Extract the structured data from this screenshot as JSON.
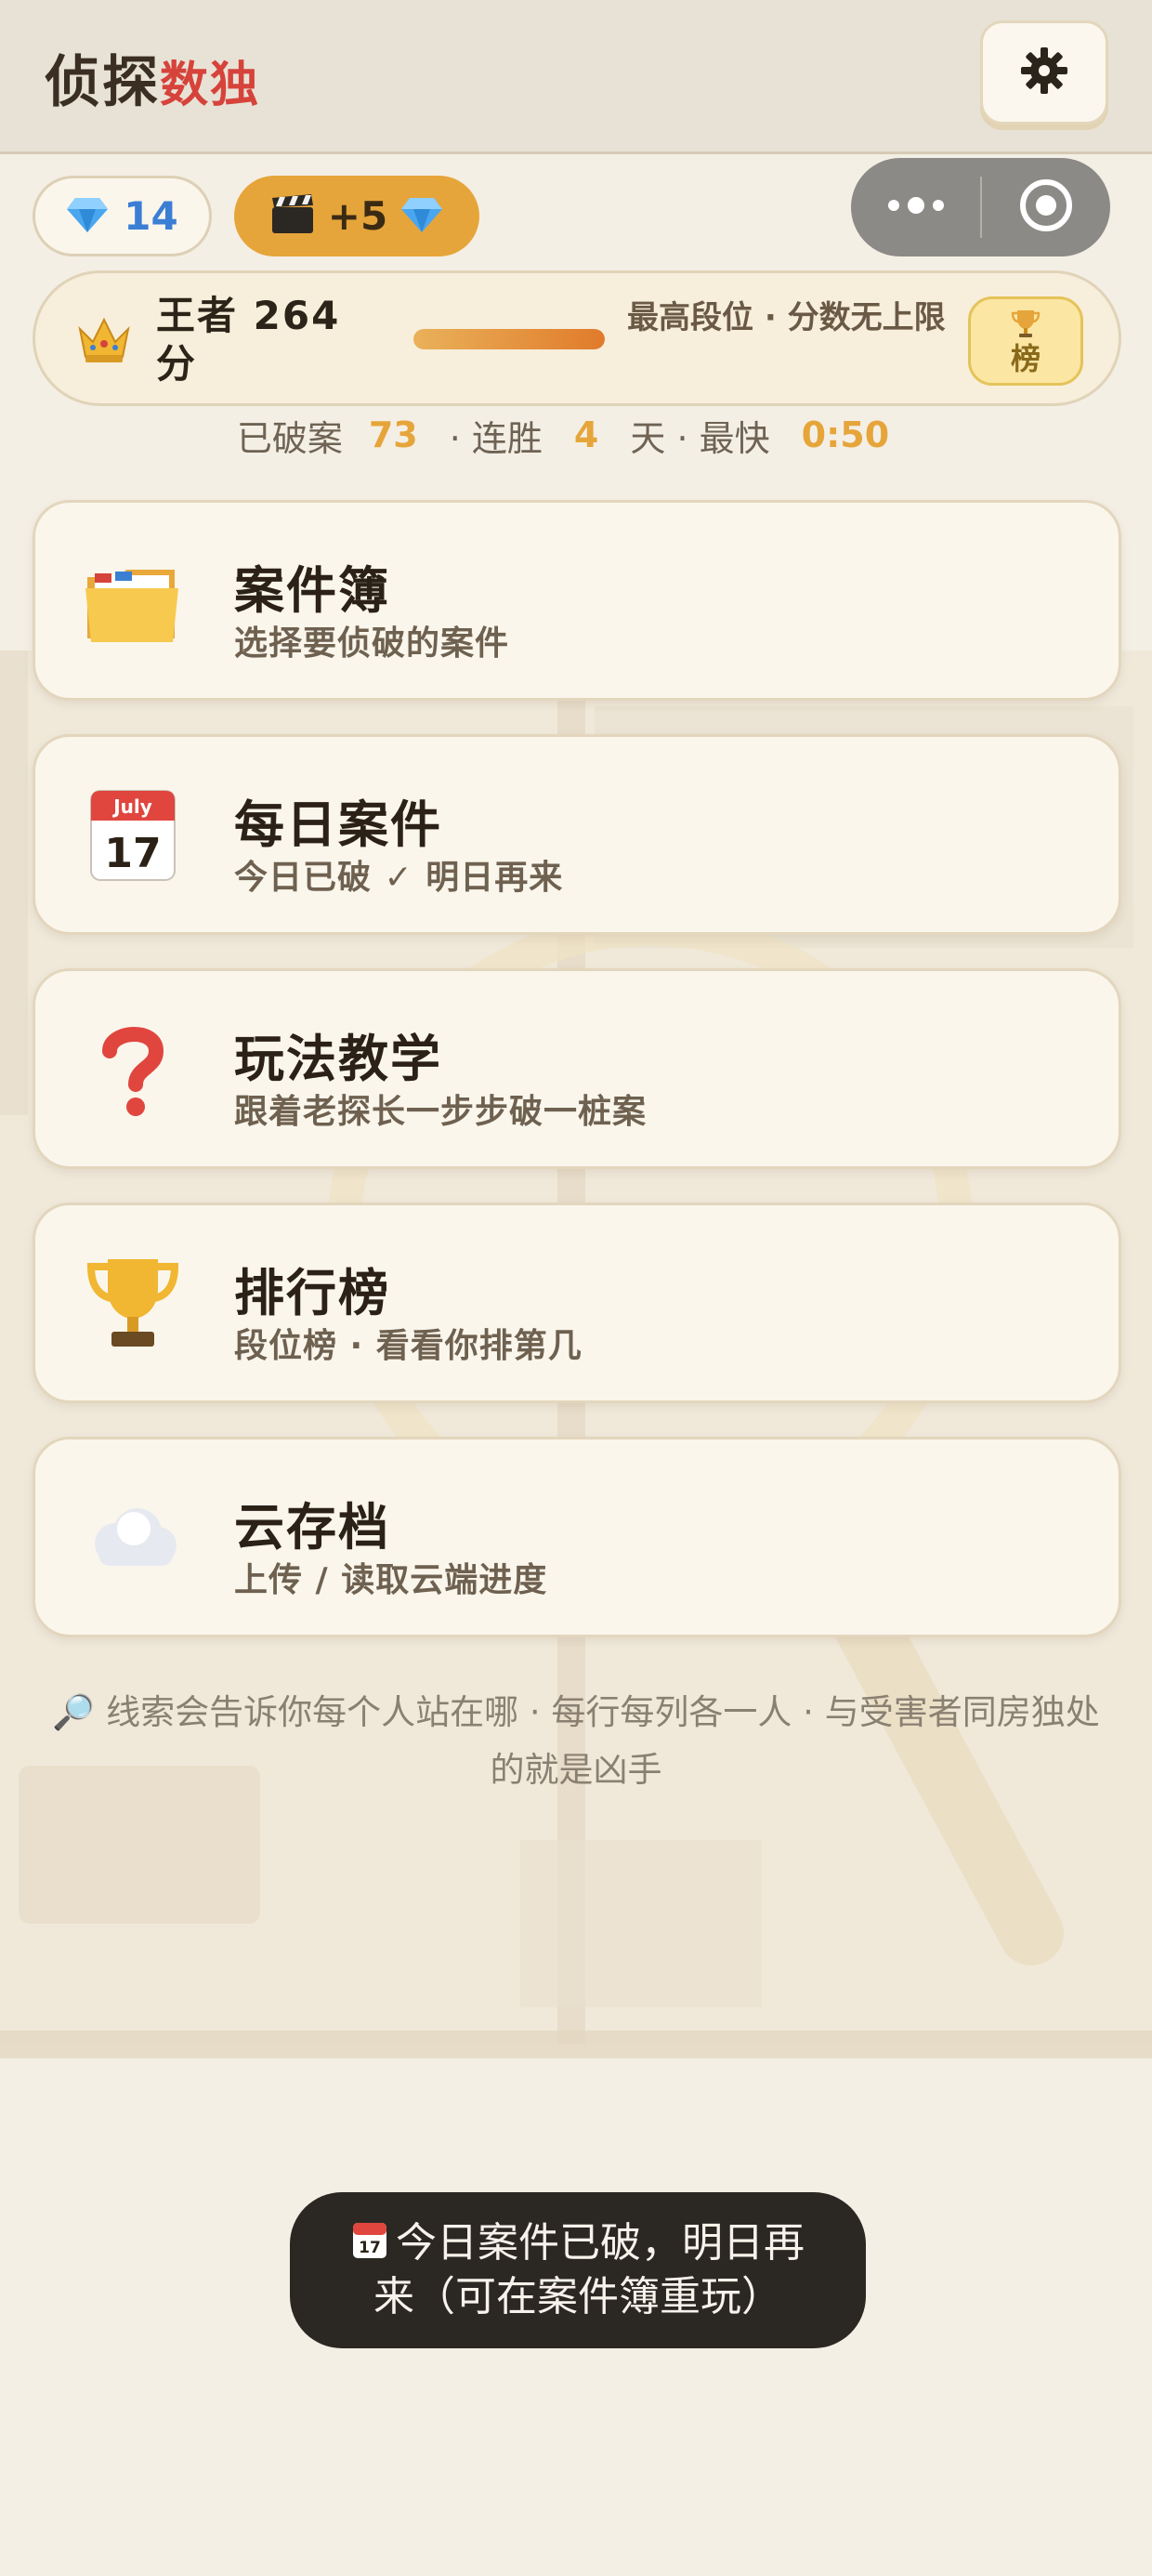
{
  "header": {
    "title_part1": "侦探",
    "title_part2": "数独"
  },
  "currency": {
    "gems": "14",
    "ad_reward": "+5"
  },
  "rank": {
    "title": "王者 264 分",
    "progress_percent": 100,
    "note": "最高段位 · 分数无上限",
    "board_button_label": "榜"
  },
  "stats": {
    "solved_label": "已破案",
    "solved_value": "73",
    "streak_label": "· 连胜",
    "streak_value": "4",
    "fastest_label": "天 · 最快",
    "fastest_value": "0:50"
  },
  "menu": [
    {
      "icon": "folder-icon",
      "label": "案件簿",
      "subtitle": "选择要侦破的案件"
    },
    {
      "icon": "calendar-icon",
      "label": "每日案件",
      "subtitle": "今日已破 ✓ 明日再来"
    },
    {
      "icon": "question-icon",
      "label": "玩法教学",
      "subtitle": "跟着老探长一步步破一桩案"
    },
    {
      "icon": "trophy-icon",
      "label": "排行榜",
      "subtitle": "段位榜 · 看看你排第几"
    },
    {
      "icon": "cloud-icon",
      "label": "云存档",
      "subtitle": "上传 / 读取云端进度"
    }
  ],
  "hint": "🔎 线索会告诉你每个人站在哪 · 每行每列各一人 · 与受害者同房独处的就是凶手",
  "toast": "今日案件已破，明日再来（可在案件簿重玩）",
  "calendar_month": "July",
  "calendar_day": "17",
  "colors": {
    "accent_orange": "#e6a53a",
    "gem_blue": "#3b7fd4",
    "title_red": "#d6433b",
    "card_bg": "#faf6ec",
    "page_bg": "#f4efe5"
  }
}
